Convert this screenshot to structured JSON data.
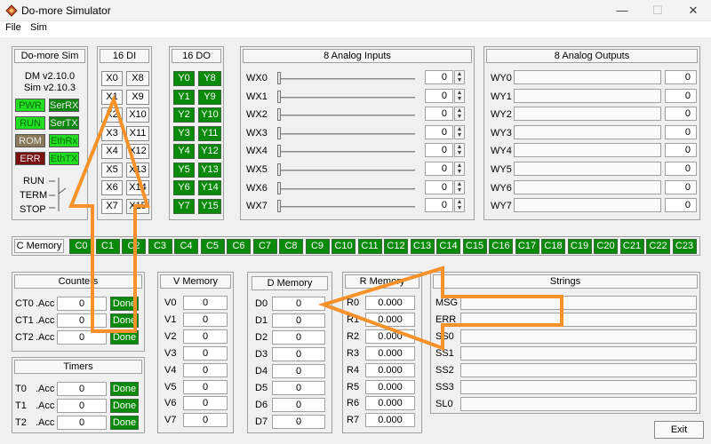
{
  "window": {
    "title": "Do-more Simulator",
    "minimize": "—",
    "maximize": "☐",
    "close": "✕"
  },
  "menu": {
    "file": "File",
    "sim": "Sim"
  },
  "sim_panel": {
    "title": "Do-more Sim",
    "version_dm": "DM v2.10.0",
    "version_sim": "Sim v2.10.3",
    "leds": [
      {
        "label": "PWR",
        "color": "#22dd22"
      },
      {
        "label": "SerRX",
        "color": "#118811"
      },
      {
        "label": "RUN",
        "color": "#22dd22"
      },
      {
        "label": "SerTX",
        "color": "#118811"
      },
      {
        "label": "ROM",
        "color": "#8a7a5a"
      },
      {
        "label": "EthRx",
        "color": "#22dd22"
      },
      {
        "label": "ERR",
        "color": "#7a1010"
      },
      {
        "label": "EthTX",
        "color": "#22dd22"
      }
    ],
    "mode_run": "RUN",
    "mode_term": "TERM",
    "mode_stop": "STOP"
  },
  "di": {
    "title": "16 DI",
    "left": [
      "X0",
      "X1",
      "X2",
      "X3",
      "X4",
      "X5",
      "X6",
      "X7"
    ],
    "right": [
      "X8",
      "X9",
      "X10",
      "X11",
      "X12",
      "X13",
      "X14",
      "X15"
    ]
  },
  "do": {
    "title": "16 DO",
    "left": [
      "Y0",
      "Y1",
      "Y2",
      "Y3",
      "Y4",
      "Y5",
      "Y6",
      "Y7"
    ],
    "right": [
      "Y8",
      "Y9",
      "Y10",
      "Y11",
      "Y12",
      "Y13",
      "Y14",
      "Y15"
    ]
  },
  "analog_in": {
    "title": "8 Analog Inputs",
    "rows": [
      {
        "label": "WX0",
        "value": "0",
        "level": 0
      },
      {
        "label": "WX1",
        "value": "0",
        "level": 0
      },
      {
        "label": "WX2",
        "value": "0",
        "level": 0
      },
      {
        "label": "WX3",
        "value": "0",
        "level": 0
      },
      {
        "label": "WX4",
        "value": "0",
        "level": 0
      },
      {
        "label": "WX5",
        "value": "0",
        "level": 0
      },
      {
        "label": "WX6",
        "value": "0",
        "level": 0
      },
      {
        "label": "WX7",
        "value": "0",
        "level": 0
      }
    ]
  },
  "analog_out": {
    "title": "8 Analog Outputs",
    "rows": [
      {
        "label": "WY0",
        "value": "0"
      },
      {
        "label": "WY1",
        "value": "0"
      },
      {
        "label": "WY2",
        "value": "0"
      },
      {
        "label": "WY3",
        "value": "0"
      },
      {
        "label": "WY4",
        "value": "0"
      },
      {
        "label": "WY5",
        "value": "0"
      },
      {
        "label": "WY6",
        "value": "0"
      },
      {
        "label": "WY7",
        "value": "0"
      }
    ]
  },
  "c_memory": {
    "title": "C Memory",
    "bits": [
      "C0",
      "C1",
      "C2",
      "C3",
      "C4",
      "C5",
      "C6",
      "C7",
      "C8",
      "C9",
      "C10",
      "C11",
      "C12",
      "C13",
      "C14",
      "C15",
      "C16",
      "C17",
      "C18",
      "C19",
      "C20",
      "C21",
      "C22",
      "C23"
    ]
  },
  "counters": {
    "title": "Counters",
    "rows": [
      {
        "label": "CT0",
        "acc": ".Acc",
        "value": "0",
        "done": "Done"
      },
      {
        "label": "CT1",
        "acc": ".Acc",
        "value": "0",
        "done": "Done"
      },
      {
        "label": "CT2",
        "acc": ".Acc",
        "value": "0",
        "done": "Done"
      }
    ]
  },
  "timers": {
    "title": "Timers",
    "rows": [
      {
        "label": "T0",
        "acc": ".Acc",
        "value": "0",
        "done": "Done"
      },
      {
        "label": "T1",
        "acc": ".Acc",
        "value": "0",
        "done": "Done"
      },
      {
        "label": "T2",
        "acc": ".Acc",
        "value": "0",
        "done": "Done"
      }
    ]
  },
  "v_memory": {
    "title": "V Memory",
    "rows": [
      {
        "label": "V0",
        "value": "0"
      },
      {
        "label": "V1",
        "value": "0"
      },
      {
        "label": "V2",
        "value": "0"
      },
      {
        "label": "V3",
        "value": "0"
      },
      {
        "label": "V4",
        "value": "0"
      },
      {
        "label": "V5",
        "value": "0"
      },
      {
        "label": "V6",
        "value": "0"
      },
      {
        "label": "V7",
        "value": "0"
      }
    ]
  },
  "d_memory": {
    "title": "D Memory",
    "rows": [
      {
        "label": "D0",
        "value": "0"
      },
      {
        "label": "D1",
        "value": "0"
      },
      {
        "label": "D2",
        "value": "0"
      },
      {
        "label": "D3",
        "value": "0"
      },
      {
        "label": "D4",
        "value": "0"
      },
      {
        "label": "D5",
        "value": "0"
      },
      {
        "label": "D6",
        "value": "0"
      },
      {
        "label": "D7",
        "value": "0"
      }
    ]
  },
  "r_memory": {
    "title": "R Memory",
    "rows": [
      {
        "label": "R0",
        "value": "0.000"
      },
      {
        "label": "R1",
        "value": "0.000"
      },
      {
        "label": "R2",
        "value": "0.000"
      },
      {
        "label": "R3",
        "value": "0.000"
      },
      {
        "label": "R4",
        "value": "0.000"
      },
      {
        "label": "R5",
        "value": "0.000"
      },
      {
        "label": "R6",
        "value": "0.000"
      },
      {
        "label": "R7",
        "value": "0.000"
      }
    ]
  },
  "strings": {
    "title": "Strings",
    "rows": [
      {
        "label": "MSG",
        "value": ""
      },
      {
        "label": "ERR",
        "value": ""
      },
      {
        "label": "SS0",
        "value": ""
      },
      {
        "label": "SS1",
        "value": ""
      },
      {
        "label": "SS2",
        "value": ""
      },
      {
        "label": "SS3",
        "value": ""
      },
      {
        "label": "SL0",
        "value": ""
      }
    ]
  },
  "exit_label": "Exit",
  "annotation_color": "#f7922a"
}
